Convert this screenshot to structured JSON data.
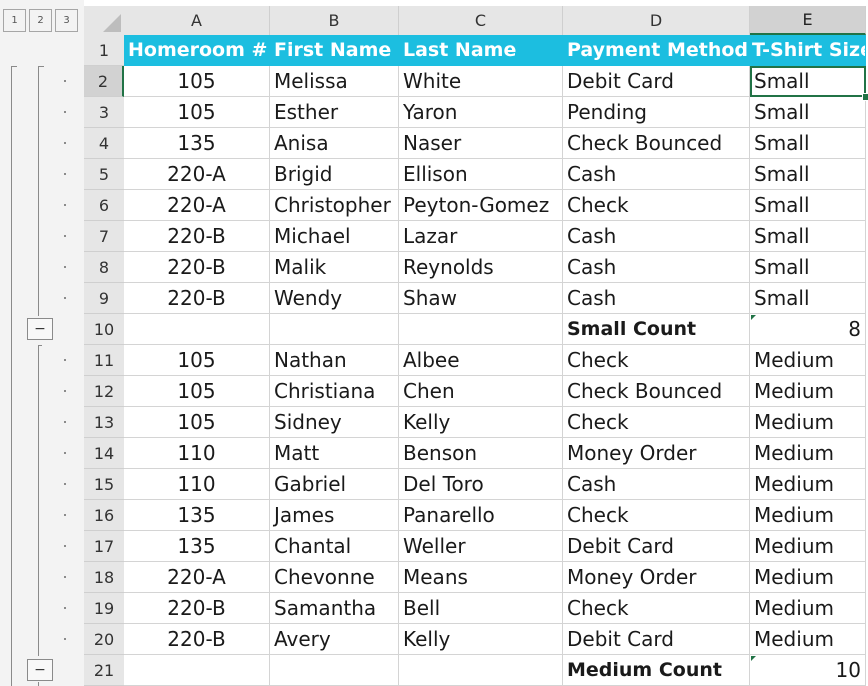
{
  "outline": {
    "levels": [
      "1",
      "2",
      "3"
    ],
    "collapse_label": "−"
  },
  "columns": [
    "A",
    "B",
    "C",
    "D",
    "E"
  ],
  "selected_cell": "E2",
  "header_row": {
    "row": "1",
    "cells": [
      "Homeroom #",
      "First Name",
      "Last Name",
      "Payment Method",
      "T-Shirt Size"
    ]
  },
  "rows": [
    {
      "row": "2",
      "cells": [
        "105",
        "Melissa",
        "White",
        "Debit Card",
        "Small"
      ]
    },
    {
      "row": "3",
      "cells": [
        "105",
        "Esther",
        "Yaron",
        "Pending",
        "Small"
      ]
    },
    {
      "row": "4",
      "cells": [
        "135",
        "Anisa",
        "Naser",
        "Check Bounced",
        "Small"
      ]
    },
    {
      "row": "5",
      "cells": [
        "220-A",
        "Brigid",
        "Ellison",
        "Cash",
        "Small"
      ]
    },
    {
      "row": "6",
      "cells": [
        "220-A",
        "Christopher",
        "Peyton-Gomez",
        "Check",
        "Small"
      ]
    },
    {
      "row": "7",
      "cells": [
        "220-B",
        "Michael",
        "Lazar",
        "Cash",
        "Small"
      ]
    },
    {
      "row": "8",
      "cells": [
        "220-B",
        "Malik",
        "Reynolds",
        "Cash",
        "Small"
      ]
    },
    {
      "row": "9",
      "cells": [
        "220-B",
        "Wendy",
        "Shaw",
        "Cash",
        "Small"
      ]
    },
    {
      "row": "10",
      "subtotal": true,
      "cells": [
        "",
        "",
        "",
        "Small Count",
        "8"
      ]
    },
    {
      "row": "11",
      "cells": [
        "105",
        "Nathan",
        "Albee",
        "Check",
        "Medium"
      ]
    },
    {
      "row": "12",
      "cells": [
        "105",
        "Christiana",
        "Chen",
        "Check Bounced",
        "Medium"
      ]
    },
    {
      "row": "13",
      "cells": [
        "105",
        "Sidney",
        "Kelly",
        "Check",
        "Medium"
      ]
    },
    {
      "row": "14",
      "cells": [
        "110",
        "Matt",
        "Benson",
        "Money Order",
        "Medium"
      ]
    },
    {
      "row": "15",
      "cells": [
        "110",
        "Gabriel",
        "Del Toro",
        "Cash",
        "Medium"
      ]
    },
    {
      "row": "16",
      "cells": [
        "135",
        "James",
        "Panarello",
        "Check",
        "Medium"
      ]
    },
    {
      "row": "17",
      "cells": [
        "135",
        "Chantal",
        "Weller",
        "Debit Card",
        "Medium"
      ]
    },
    {
      "row": "18",
      "cells": [
        "220-A",
        "Chevonne",
        "Means",
        "Money Order",
        "Medium"
      ]
    },
    {
      "row": "19",
      "cells": [
        "220-B",
        "Samantha",
        "Bell",
        "Check",
        "Medium"
      ]
    },
    {
      "row": "20",
      "cells": [
        "220-B",
        "Avery",
        "Kelly",
        "Debit Card",
        "Medium"
      ]
    },
    {
      "row": "21",
      "subtotal": true,
      "cells": [
        "",
        "",
        "",
        "Medium Count",
        "10"
      ]
    }
  ],
  "colors": {
    "header_fill": "#1cbee0",
    "selection": "#217346"
  }
}
